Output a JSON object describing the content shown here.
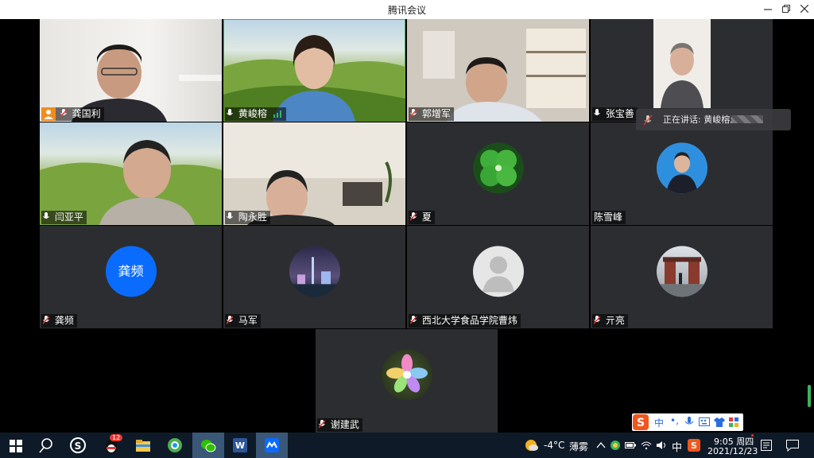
{
  "window": {
    "title": "腾讯会议"
  },
  "participants": [
    {
      "name": "龚国利"
    },
    {
      "name": "黄峻榕"
    },
    {
      "name": "郭增军"
    },
    {
      "name": "张宝善"
    },
    {
      "name": "闫亚平"
    },
    {
      "name": "陶永胜"
    },
    {
      "name": "夏"
    },
    {
      "name": "陈雪峰"
    },
    {
      "name": "龚频",
      "avatar_text": "龚频"
    },
    {
      "name": "马军"
    },
    {
      "name": "西北大学食品学院曹炜"
    },
    {
      "name": "亓亮"
    },
    {
      "name": "谢建武"
    }
  ],
  "speaking": {
    "label": "正在讲话: 黄峻榕;"
  },
  "taskbar": {
    "weather": "-4°C",
    "weather_desc": "薄雾",
    "ime_mode": "中",
    "time": "9:05 周四",
    "date": "2021/12/23",
    "qq_badge": "12"
  },
  "ime_bar": {
    "mode": "中"
  },
  "colors": {
    "accent_blue": "#0a6cff",
    "tile_bg": "#2c2d30",
    "active_border": "#3bb35a"
  }
}
